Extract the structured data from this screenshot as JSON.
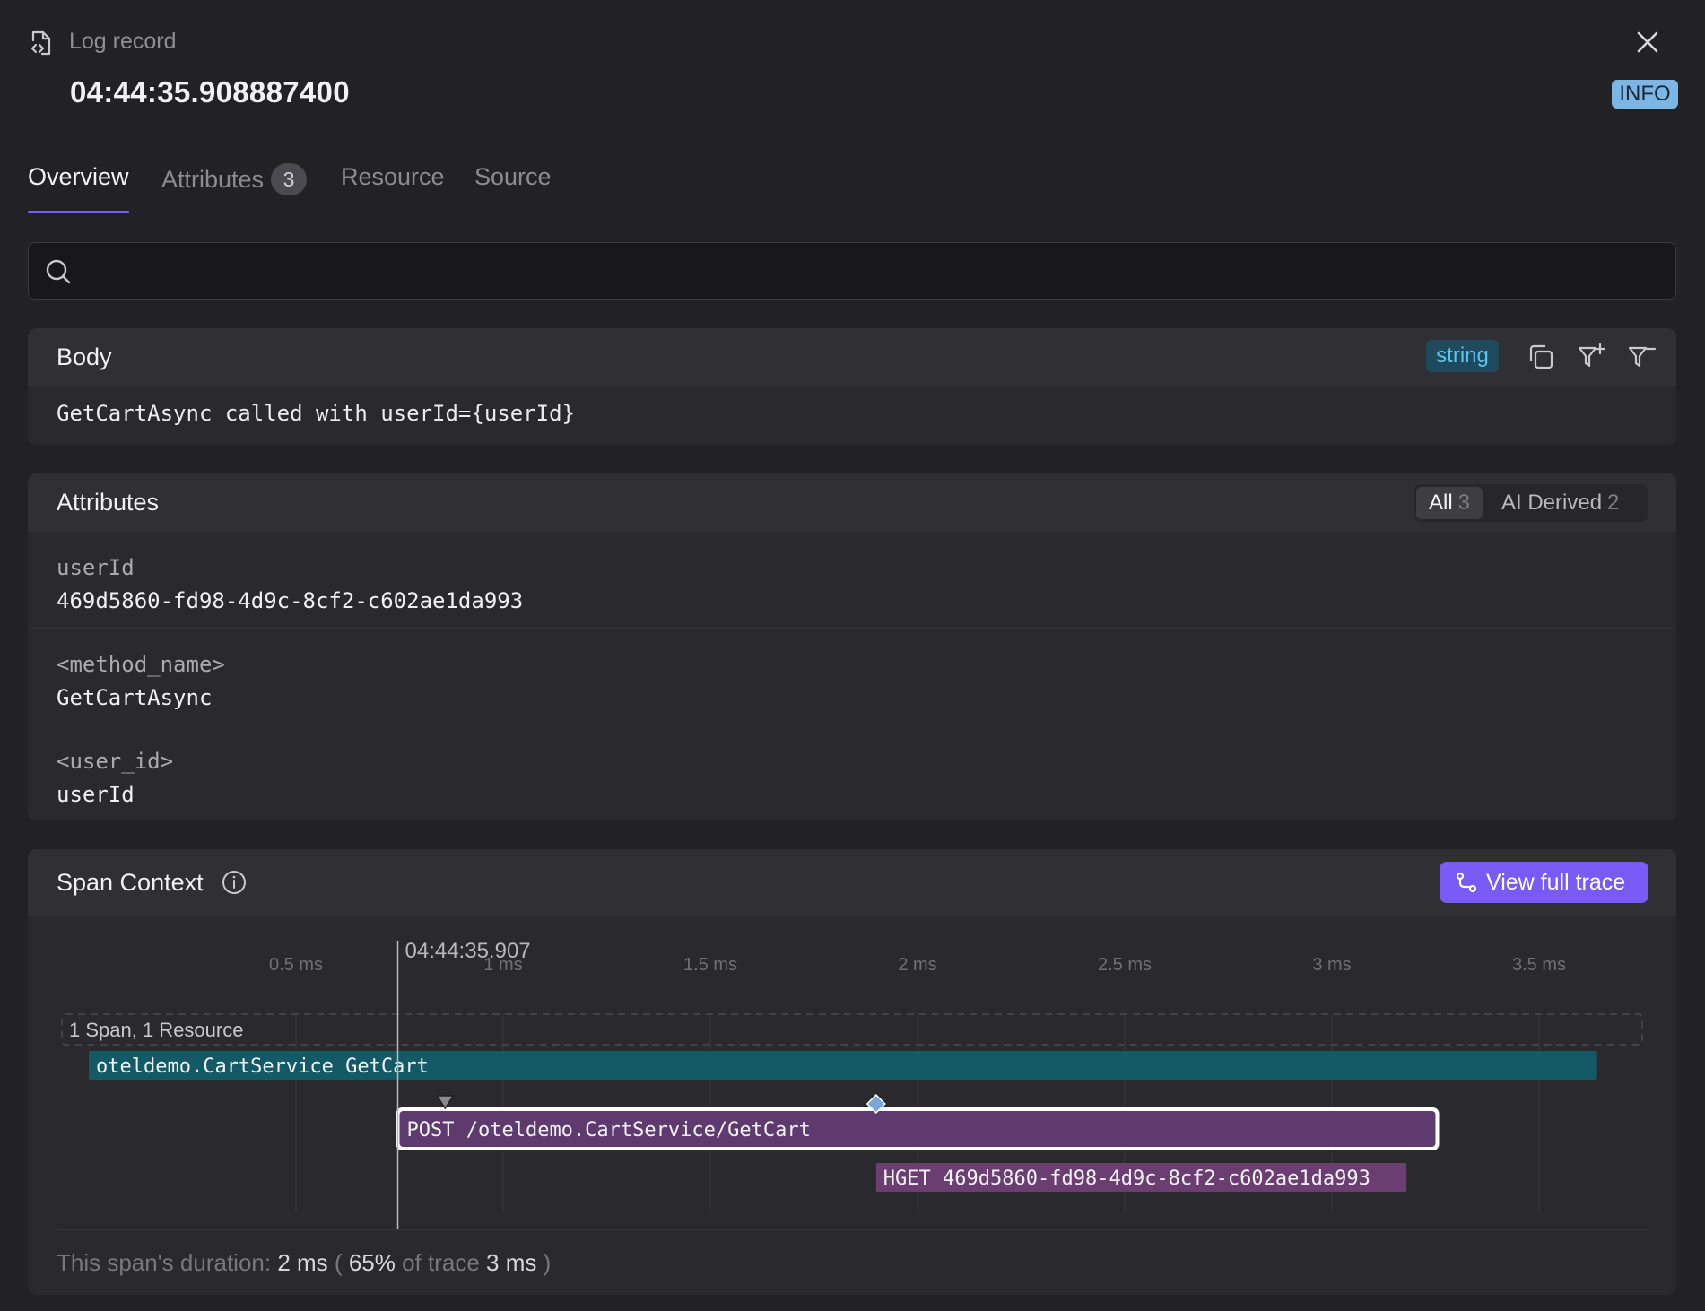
{
  "header": {
    "label": "Log record",
    "timestamp": "04:44:35.908887400",
    "level": "INFO"
  },
  "tabs": [
    {
      "label": "Overview",
      "active": true
    },
    {
      "label": "Attributes",
      "count": "3"
    },
    {
      "label": "Resource"
    },
    {
      "label": "Source"
    }
  ],
  "search": {
    "value": "",
    "placeholder": ""
  },
  "body": {
    "title": "Body",
    "type": "string",
    "value": "GetCartAsync called with userId={userId}"
  },
  "attributes": {
    "title": "Attributes",
    "filters": [
      {
        "label": "All",
        "count": "3",
        "active": true
      },
      {
        "label": "AI Derived",
        "count": "2"
      }
    ],
    "rows": [
      {
        "key": "userId",
        "value": "469d5860-fd98-4d9c-8cf2-c602ae1da993"
      },
      {
        "key": "<method_name>",
        "value": "GetCartAsync"
      },
      {
        "key": "<user_id>",
        "value": "userId"
      }
    ]
  },
  "span_context": {
    "title": "Span Context",
    "button": "View full trace",
    "marker_time": "04:44:35.907",
    "ticks": [
      "0.5 ms",
      "1 ms",
      "1.5 ms",
      "2 ms",
      "2.5 ms",
      "3 ms",
      "3.5 ms"
    ],
    "group_label": "1 Span, 1 Resource",
    "spans": [
      {
        "name": "oteldemo.CartService GetCart",
        "start_ms": 0.0,
        "end_ms": 3.64,
        "color": "#135a66",
        "selected": false
      },
      {
        "name": "POST /oteldemo.CartService/GetCart",
        "start_ms": 0.75,
        "end_ms": 3.25,
        "color": "#5e3a6e",
        "selected": true
      },
      {
        "name": "HGET 469d5860-fd98-4d9c-8cf2-c602ae1da993",
        "start_ms": 1.9,
        "end_ms": 3.18,
        "color": "#6b3e72",
        "selected": false
      }
    ],
    "marker_ms": 0.75,
    "event_markers_ms": [
      0.86,
      1.9
    ],
    "footer": {
      "prefix": "This span's duration:",
      "duration": "2 ms",
      "open_paren": "(",
      "percent": "65%",
      "of_trace": "of trace",
      "trace_duration": "3 ms",
      "close_paren": ")"
    }
  },
  "colors": {
    "accent": "#7a5af5",
    "info_badge": "#7cb6e4",
    "string_badge": "#5ec4ee"
  }
}
